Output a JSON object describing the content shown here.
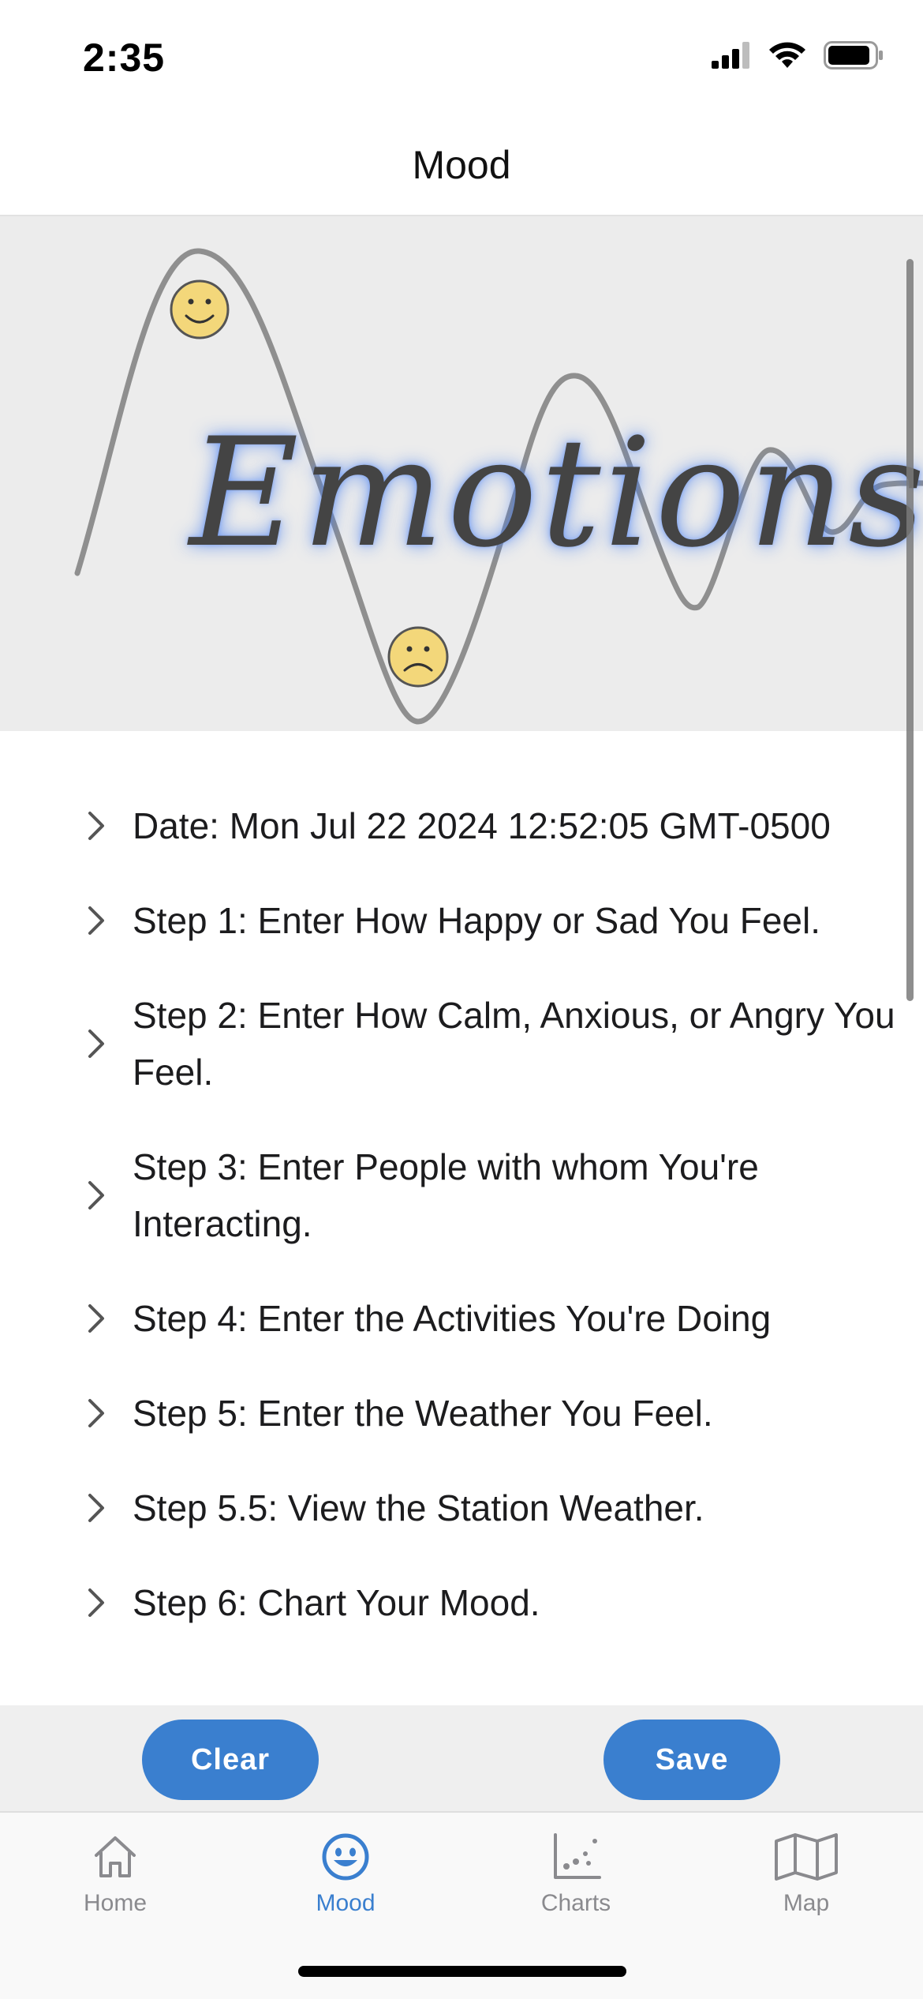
{
  "status_bar": {
    "time": "2:35",
    "icons": [
      "cellular-signal-icon",
      "wifi-icon",
      "battery-icon"
    ]
  },
  "header": {
    "title": "Mood"
  },
  "banner": {
    "word": "Emotions",
    "icons": [
      "happy-face-icon",
      "sad-face-icon"
    ]
  },
  "steps": [
    {
      "label": "Date: Mon Jul 22 2024 12:52:05 GMT-0500"
    },
    {
      "label": "Step 1: Enter How Happy or Sad You Feel."
    },
    {
      "label": "Step 2: Enter How Calm, Anxious, or Angry You Feel."
    },
    {
      "label": "Step 3: Enter People with whom You're Interacting."
    },
    {
      "label": "Step 4: Enter the Activities You're Doing"
    },
    {
      "label": "Step 5: Enter the Weather You Feel."
    },
    {
      "label": "Step 5.5: View the Station Weather."
    },
    {
      "label": "Step 6: Chart Your Mood."
    }
  ],
  "actions": {
    "clear_label": "Clear",
    "save_label": "Save"
  },
  "tabs": [
    {
      "label": "Home",
      "icon": "home-icon"
    },
    {
      "label": "Mood",
      "icon": "smiley-icon",
      "active": true
    },
    {
      "label": "Charts",
      "icon": "scatter-chart-icon"
    },
    {
      "label": "Map",
      "icon": "map-icon"
    }
  ],
  "colors": {
    "accent": "#3a7fcf",
    "tab_inactive": "#8a8a8e",
    "banner_bg": "#ececec",
    "action_bar_bg": "#efefef"
  }
}
